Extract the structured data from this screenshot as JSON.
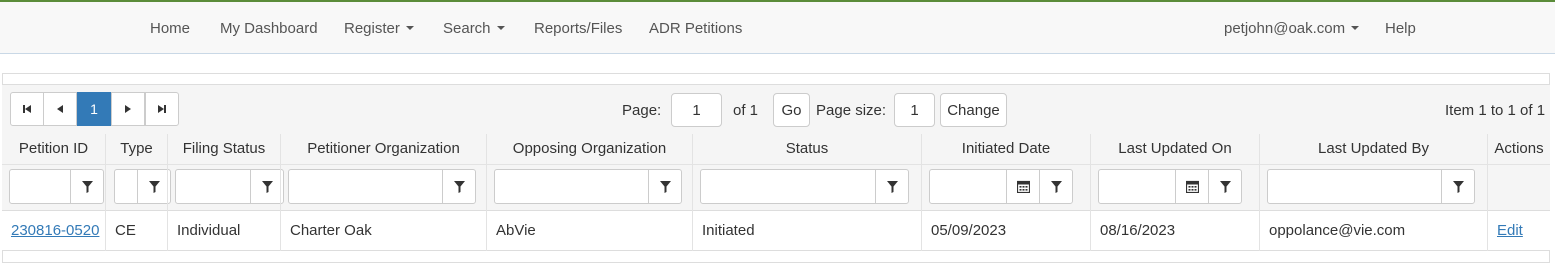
{
  "navbar": {
    "items": [
      {
        "label": "Home"
      },
      {
        "label": "My Dashboard"
      },
      {
        "label": "Register"
      },
      {
        "label": "Search"
      },
      {
        "label": "Reports/Files"
      },
      {
        "label": "ADR Petitions"
      }
    ],
    "user_email": "petjohn@oak.com",
    "help": "Help"
  },
  "pager": {
    "current_page": "1",
    "page_label": "Page:",
    "page_input_value": "1",
    "of_label": "of 1",
    "go_label": "Go",
    "page_size_label": "Page size:",
    "page_size_value": "1",
    "change_label": "Change",
    "item_info": "Item 1 to 1 of 1"
  },
  "columns": [
    "Petition ID",
    "Type",
    "Filing Status",
    "Petitioner Organization",
    "Opposing Organization",
    "Status",
    "Initiated Date",
    "Last Updated On",
    "Last Updated By",
    "Actions"
  ],
  "rows": [
    {
      "petition_id": "230816-0520",
      "type": "CE",
      "filing_status": "Individual",
      "petitioner_org": "Charter Oak",
      "opposing_org": "AbVie",
      "status": "Initiated",
      "initiated_date": "05/09/2023",
      "last_updated_on": "08/16/2023",
      "last_updated_by": "oppolance@vie.com",
      "action": "Edit"
    }
  ],
  "colors": {
    "accent": "#337ab7",
    "navbar_top_border": "#5b8c3a"
  }
}
